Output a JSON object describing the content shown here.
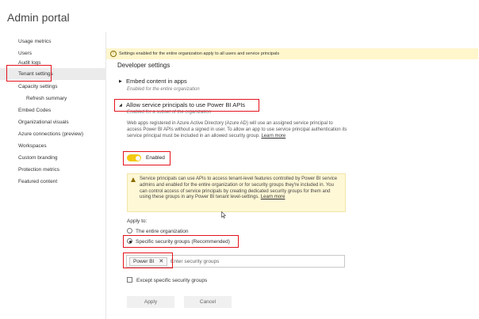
{
  "header": {
    "title": "Admin portal"
  },
  "sidebar": {
    "items": [
      {
        "label": "Usage metrics"
      },
      {
        "label": "Users"
      },
      {
        "label": "Audit logs"
      },
      {
        "label": "Tenant settings"
      },
      {
        "label": "Capacity settings"
      },
      {
        "label": "Refresh summary"
      },
      {
        "label": "Embed Codes"
      },
      {
        "label": "Organizational visuals"
      },
      {
        "label": "Azure connections (preview)"
      },
      {
        "label": "Workspaces"
      },
      {
        "label": "Custom branding"
      },
      {
        "label": "Protection metrics"
      },
      {
        "label": "Featured content"
      }
    ],
    "active": "Tenant settings"
  },
  "banner": {
    "text": "Settings enabled for the entire organization apply to all users and service principals"
  },
  "main": {
    "section_title": "Developer settings",
    "embed": {
      "title": "Embed content in apps",
      "note": "Enabled for the entire organization"
    },
    "service_principals": {
      "title": "Allow service principals to use Power BI APIs",
      "note": "Enabled for a subset of the organization",
      "description": "Web apps registered in Azure Active Directory (Azure AD) will use an assigned service principal to access Power BI APIs without a signed in user. To allow an app to use service principal authentication its service principal must be included in an allowed security group.",
      "learn_more": "Learn more",
      "toggle_label": "Enabled",
      "toggle_on": true,
      "info_text": "Service principals can use APIs to access tenant-level features controlled by Power BI service admins and enabled for the entire organization or for security groups they're included in. You can control access of service principals by creating dedicated security groups for them and using these groups in any Power BI tenant level-settings.",
      "info_learn_more": "Learn more",
      "apply_to_label": "Apply to:",
      "option_entire": "The entire organization",
      "option_specific": "Specific security groups (Recommended)",
      "selected_option": "Specific security groups (Recommended)",
      "group_chip": "Power BI",
      "group_placeholder": "Enter security groups",
      "except_label": "Except specific security groups",
      "except_checked": false
    },
    "apply_button": "Apply",
    "cancel_button": "Cancel"
  },
  "colors": {
    "toggle_on": "#f2c811",
    "highlight": "#e3121c",
    "banner_bg": "#fff6cc"
  }
}
